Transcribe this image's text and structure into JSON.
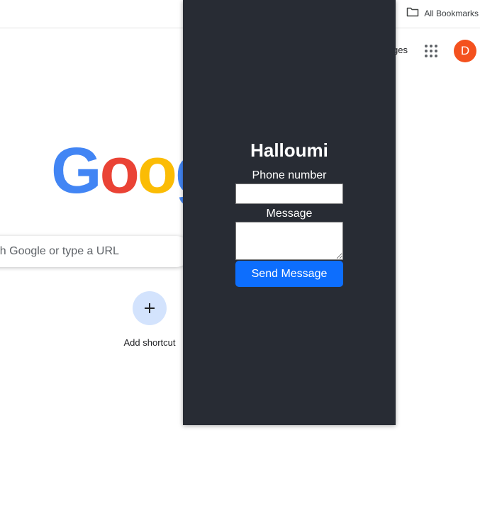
{
  "bookmarks_bar": {
    "all_bookmarks_label": "All Bookmarks",
    "icon": "folder-icon"
  },
  "ntp": {
    "header": {
      "images_link_label": "Images",
      "apps_icon": "apps-grid-icon",
      "avatar_initial": "D",
      "avatar_color": "#f4511e"
    },
    "logo": {
      "letters": [
        "G",
        "o",
        "o",
        "g"
      ],
      "colors": [
        "#4285f4",
        "#ea4335",
        "#fbbc05",
        "#4285f4"
      ]
    },
    "search": {
      "placeholder": "Search Google or type a URL"
    },
    "shortcut": {
      "label": "Add shortcut",
      "icon": "plus-icon"
    }
  },
  "popup": {
    "title": "Halloumi",
    "phone_label": "Phone number",
    "phone_value": "",
    "message_label": "Message",
    "message_value": "",
    "send_button_label": "Send Message",
    "background_color": "#282c34",
    "button_color": "#0d6efd"
  }
}
